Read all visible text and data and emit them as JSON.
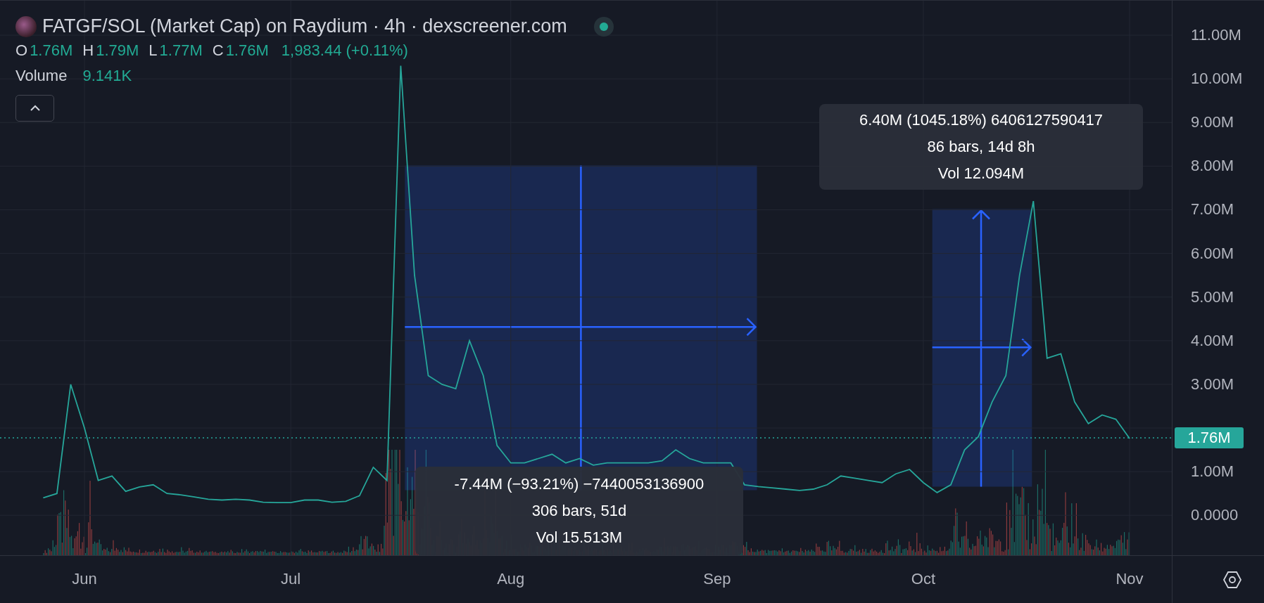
{
  "header": {
    "title": "FATGF/SOL (Market Cap) on Raydium · 4h · dexscreener.com",
    "ohlc": [
      {
        "label": "O",
        "value": "1.76M"
      },
      {
        "label": "H",
        "value": "1.79M"
      },
      {
        "label": "L",
        "value": "1.77M"
      },
      {
        "label": "C",
        "value": "1.76M"
      }
    ],
    "change": "1,983.44 (+0.11%)",
    "volume": {
      "label": "Volume",
      "value": "9.141K"
    }
  },
  "chart": {
    "price_tag": "1.76M",
    "chart_data": {
      "type": "line",
      "categories": [
        null,
        null,
        null,
        "Jun",
        null,
        null,
        null,
        null,
        null,
        null,
        null,
        null,
        null,
        null,
        null,
        null,
        null,
        null,
        "Jul",
        null,
        null,
        null,
        null,
        null,
        null,
        null,
        null,
        null,
        null,
        null,
        null,
        null,
        null,
        null,
        "Aug",
        null,
        null,
        null,
        null,
        null,
        null,
        null,
        null,
        null,
        null,
        null,
        null,
        null,
        null,
        "Sep",
        null,
        null,
        null,
        null,
        null,
        null,
        null,
        null,
        null,
        null,
        null,
        null,
        null,
        null,
        "Oct",
        null,
        null,
        null,
        null,
        null,
        null,
        null,
        null,
        null,
        null,
        null,
        null,
        null,
        null,
        "Nov"
      ],
      "series": [
        {
          "color": "#26a69a",
          "values": [
            0.4,
            0.5,
            3.0,
            2.0,
            0.8,
            0.9,
            0.55,
            0.65,
            0.7,
            0.5,
            0.47,
            0.42,
            0.37,
            0.35,
            0.37,
            0.35,
            0.3,
            0.29,
            0.29,
            0.35,
            0.35,
            0.3,
            0.32,
            0.45,
            1.1,
            0.8,
            10.3,
            5.5,
            3.2,
            3.0,
            2.9,
            4.0,
            3.2,
            1.6,
            1.2,
            1.2,
            1.3,
            1.4,
            1.2,
            1.3,
            1.15,
            1.2,
            1.2,
            1.2,
            1.2,
            1.25,
            1.5,
            1.3,
            1.2,
            1.2,
            1.2,
            0.7,
            0.66,
            0.63,
            0.6,
            0.57,
            0.6,
            0.7,
            0.9,
            0.85,
            0.8,
            0.75,
            0.95,
            1.05,
            0.75,
            0.52,
            0.7,
            1.5,
            1.8,
            2.6,
            3.2,
            5.5,
            7.2,
            3.6,
            3.7,
            2.6,
            2.1,
            2.3,
            2.2,
            1.76
          ]
        }
      ],
      "grid": true,
      "ylim": [
        -0.93,
        11.79
      ],
      "yticks": [
        {
          "value": 0,
          "label": "0.0000"
        },
        {
          "value": 1,
          "label": "1.00M"
        },
        {
          "value": 3,
          "label": "3.00M"
        },
        {
          "value": 4,
          "label": "4.00M"
        },
        {
          "value": 5,
          "label": "5.00M"
        },
        {
          "value": 6,
          "label": "6.00M"
        },
        {
          "value": 7,
          "label": "7.00M"
        },
        {
          "value": 8,
          "label": "8.00M"
        },
        {
          "value": 9,
          "label": "9.00M"
        },
        {
          "value": 10,
          "label": "10.00M"
        },
        {
          "value": 11,
          "label": "11.00M"
        }
      ]
    }
  },
  "measurements": [
    {
      "lines": [
        "-7.44M (−93.21%) −7440053136900",
        "306 bars, 51d",
        "Vol 15.513M"
      ]
    },
    {
      "lines": [
        "6.40M (1045.18%) 6406127590417",
        "86 bars, 14d 8h",
        "Vol 12.094M"
      ]
    }
  ]
}
